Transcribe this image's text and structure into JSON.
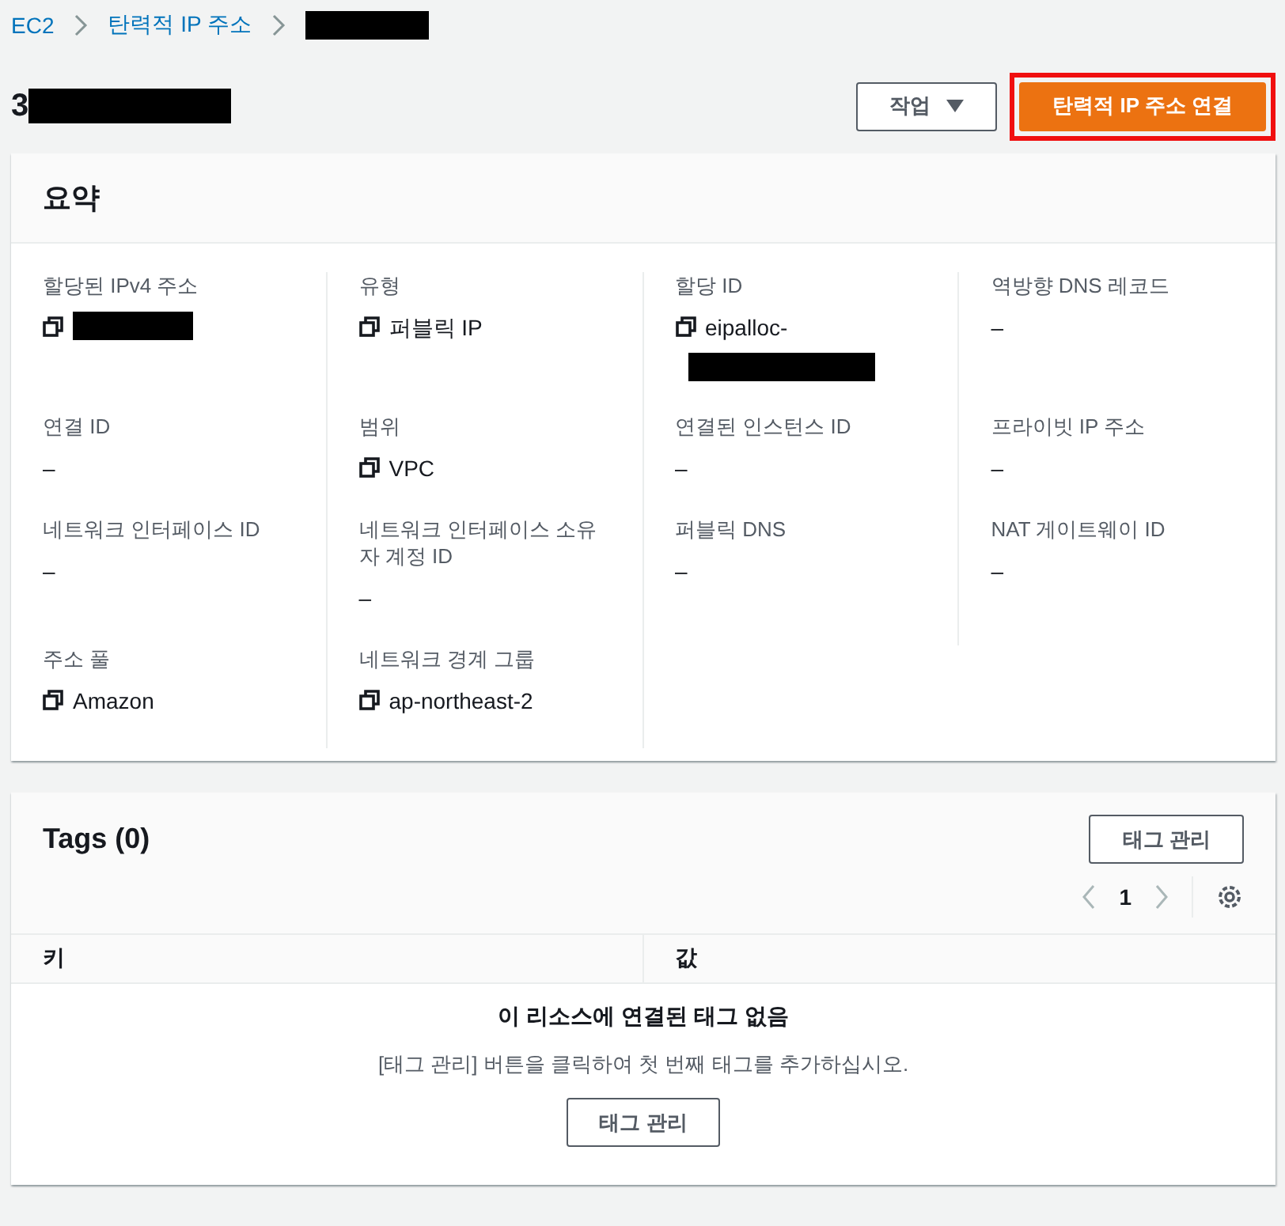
{
  "breadcrumbs": [
    {
      "label": "EC2",
      "kind": "link"
    },
    {
      "label": "탄력적 IP 주소",
      "kind": "link"
    },
    {
      "kind": "redacted"
    }
  ],
  "header": {
    "title": "3",
    "title_redacted": true,
    "actions_button": "작업",
    "primary_button": "탄력적 IP 주소 연결",
    "primary_highlighted": true
  },
  "summary": {
    "title": "요약",
    "fields": [
      {
        "label": "할당된 IPv4 주소",
        "copyable": true,
        "redacted": true
      },
      {
        "label": "유형",
        "value": "퍼블릭 IP",
        "copyable": true,
        "redacted": false
      },
      {
        "label": "할당 ID",
        "value": "eipalloc-",
        "copyable": true,
        "redacted": true
      },
      {
        "label": "역방향 DNS 레코드",
        "value": "–",
        "copyable": false,
        "redacted": false
      },
      {
        "label": "연결 ID",
        "value": "–",
        "copyable": false,
        "redacted": false
      },
      {
        "label": "범위",
        "value": "VPC",
        "copyable": true,
        "redacted": false
      },
      {
        "label": "연결된 인스턴스 ID",
        "value": "–",
        "copyable": false,
        "redacted": false
      },
      {
        "label": "프라이빗 IP 주소",
        "value": "–",
        "copyable": false,
        "redacted": false
      },
      {
        "label": "네트워크 인터페이스 ID",
        "value": "–",
        "copyable": false,
        "redacted": false
      },
      {
        "label": "네트워크 인터페이스 소유자 계정 ID",
        "value": "–",
        "copyable": false,
        "redacted": false
      },
      {
        "label": "퍼블릭 DNS",
        "value": "–",
        "copyable": false,
        "redacted": false
      },
      {
        "label": "NAT 게이트웨이 ID",
        "value": "–",
        "copyable": false,
        "redacted": false
      },
      {
        "label": "주소 풀",
        "value": "Amazon",
        "copyable": true,
        "redacted": false
      },
      {
        "label": "네트워크 경계 그룹",
        "value": "ap-northeast-2",
        "copyable": true,
        "redacted": false
      }
    ]
  },
  "tags": {
    "title": "Tags (0)",
    "manage_button": "태그 관리",
    "page": "1",
    "columns": [
      "키",
      "값"
    ],
    "empty_title": "이 리소스에 연결된 태그 없음",
    "empty_text": "[태그 관리] 버튼을 클릭하여 첫 번째 태그를 추가하십시오.",
    "empty_button": "태그 관리"
  }
}
